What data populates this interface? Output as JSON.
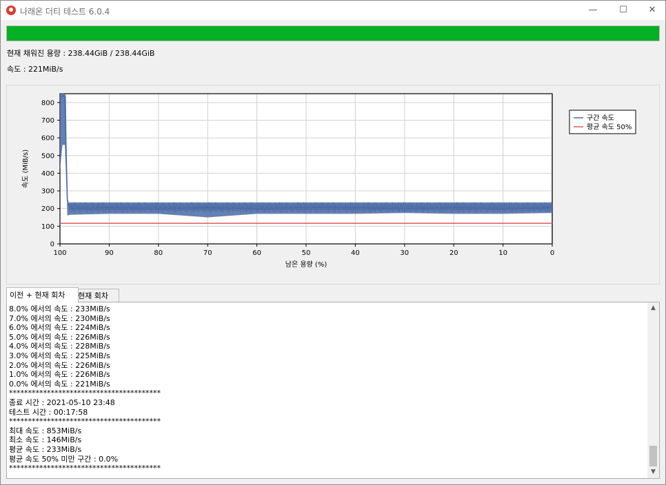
{
  "window": {
    "title": "나래온 더티 테스트 6.0.4",
    "minimize": "—",
    "maximize": "☐",
    "close": "✕"
  },
  "progress": {
    "value": 1.0,
    "color": "#06b025"
  },
  "status": {
    "capacity": "현재 채워진 용량 : 238.44GiB / 238.44GiB",
    "speed": "속도 : 221MiB/s"
  },
  "chart_data": {
    "type": "line",
    "xlabel": "남은 용량 (%)",
    "ylabel": "속도 (MiB/s)",
    "xlim": [
      100,
      0
    ],
    "ylim": [
      0,
      850
    ],
    "xticks": [
      "100",
      "90",
      "80",
      "70",
      "60",
      "50",
      "40",
      "30",
      "20",
      "10",
      "0"
    ],
    "yticks": [
      "0",
      "100",
      "200",
      "300",
      "400",
      "500",
      "600",
      "700",
      "800"
    ],
    "grid": true,
    "legend_position": "right",
    "series": [
      {
        "name": "구간 속도",
        "color": "#4a6aa5",
        "x": [
          100,
          99.5,
          99.0,
          98.8,
          98.5,
          98.0,
          90,
          80,
          70,
          60,
          50,
          40,
          30,
          20,
          10,
          0
        ],
        "y": [
          820,
          840,
          830,
          580,
          250,
          200,
          205,
          200,
          205,
          200,
          205,
          205,
          200,
          205,
          200,
          205
        ],
        "min_y": [
          420,
          560,
          560,
          400,
          160,
          165,
          170,
          170,
          150,
          170,
          170,
          170,
          175,
          170,
          170,
          175
        ],
        "max_y": [
          850,
          853,
          850,
          840,
          230,
          235,
          235,
          235,
          235,
          235,
          235,
          235,
          235,
          235,
          235,
          235
        ]
      },
      {
        "name": "평균 속도 50%",
        "color": "#e05a5a",
        "x": [
          100,
          0
        ],
        "y": [
          116.5,
          116.5
        ]
      }
    ]
  },
  "tabs": [
    {
      "label": "이전 + 현재 회차"
    },
    {
      "label": "현재 회차"
    }
  ],
  "log": {
    "lines": [
      "8.0% 에서의 속도 : 233MiB/s",
      "7.0% 에서의 속도 : 230MiB/s",
      "6.0% 에서의 속도 : 224MiB/s",
      "5.0% 에서의 속도 : 226MiB/s",
      "4.0% 에서의 속도 : 228MiB/s",
      "3.0% 에서의 속도 : 225MiB/s",
      "2.0% 에서의 속도 : 226MiB/s",
      "1.0% 에서의 속도 : 226MiB/s",
      "0.0% 에서의 속도 : 221MiB/s",
      "****************************************",
      "종료 시간 : 2021-05-10 23:48",
      "테스트 시간 : 00:17:58",
      "****************************************",
      "최대 속도 : 853MiB/s",
      "최소 속도 : 146MiB/s",
      "평균 속도 : 233MiB/s",
      "평균 속도 50% 미만 구간 : 0.0%",
      "****************************************"
    ]
  }
}
